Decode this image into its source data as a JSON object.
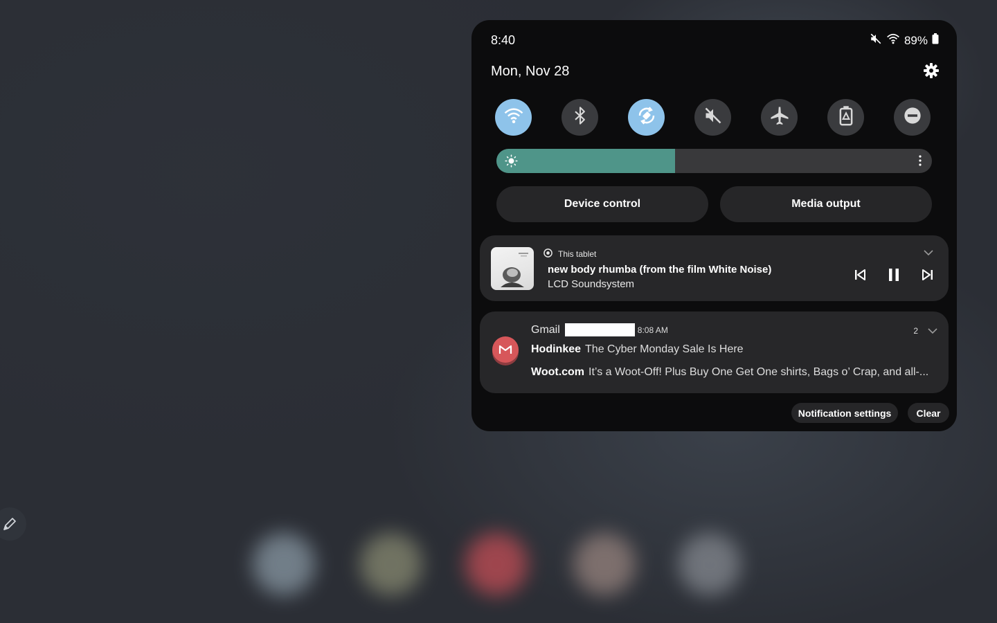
{
  "status_bar": {
    "time": "8:40",
    "battery_text": "89%",
    "icons": [
      "mute-icon",
      "wifi-icon",
      "battery-icon"
    ]
  },
  "header": {
    "date": "Mon, Nov 28",
    "settings_icon": "gear-icon"
  },
  "quick_settings": {
    "tiles": [
      {
        "icon": "wifi-icon",
        "active": true
      },
      {
        "icon": "bluetooth-icon",
        "active": false
      },
      {
        "icon": "auto-rotate-icon",
        "active": true
      },
      {
        "icon": "mute-icon",
        "active": false
      },
      {
        "icon": "airplane-icon",
        "active": false
      },
      {
        "icon": "power-saving-icon",
        "active": false
      },
      {
        "icon": "do-not-disturb-icon",
        "active": false
      }
    ],
    "brightness_level": 0.41,
    "accent_color": "#8ec3ea",
    "brightness_color": "#4f9589"
  },
  "buttons": {
    "device_control": "Device control",
    "media_output": "Media output"
  },
  "media": {
    "source": "This tablet",
    "title": "new body rhumba (from the film White Noise)",
    "artist": "LCD Soundsystem"
  },
  "gmail": {
    "app": "Gmail",
    "time": "8:08 AM",
    "count": "2",
    "messages": [
      {
        "sender": "Hodinkee",
        "subject": "The Cyber Monday Sale Is Here"
      },
      {
        "sender": "Woot.com",
        "subject": "It’s a Woot-Off! Plus Buy One Get One shirts, Bags o’ Crap, and all-..."
      }
    ],
    "avatar_color": "#d7575a"
  },
  "footer": {
    "notification_settings": "Notification settings",
    "clear": "Clear"
  }
}
